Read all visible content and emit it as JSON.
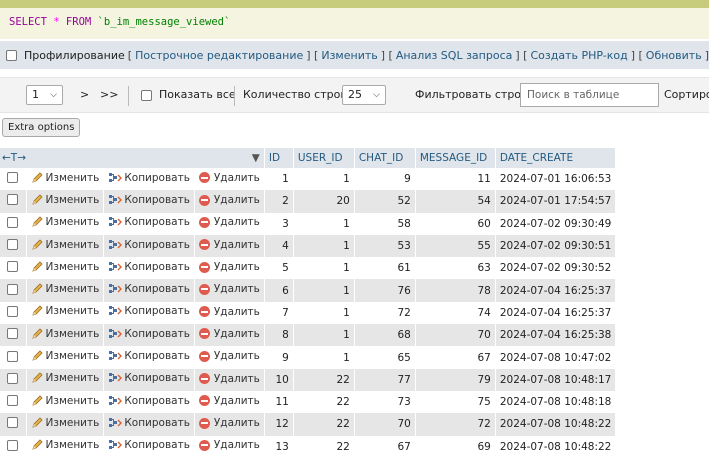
{
  "sql": {
    "keyword1": "SELECT",
    "star": "*",
    "keyword2": "FROM",
    "table": "`b_im_message_viewed`"
  },
  "links": {
    "profiling_label": "Профилирование",
    "items": [
      "Построчное редактирование",
      "Изменить",
      "Анализ SQL запроса",
      "Создать PHP-код",
      "Обновить"
    ]
  },
  "nav": {
    "page_value": "1",
    "next": ">",
    "last": ">>",
    "show_all": "Показать все",
    "rows_label": "Количество строк:",
    "rows_value": "25",
    "filter_label": "Фильтровать строки:",
    "search_placeholder": "Поиск в таблице",
    "sort_label": "Сортиров"
  },
  "extra_options": "Extra options",
  "table": {
    "toggle_symbol": "←T→",
    "sort_indicator": "▼",
    "columns": [
      "ID",
      "USER_ID",
      "CHAT_ID",
      "MESSAGE_ID",
      "DATE_CREATE"
    ],
    "actions": {
      "edit": "Изменить",
      "copy": "Копировать",
      "delete": "Удалить"
    },
    "rows": [
      [
        "1",
        "1",
        "9",
        "11",
        "2024-07-01 16:06:53"
      ],
      [
        "2",
        "20",
        "52",
        "54",
        "2024-07-01 17:54:57"
      ],
      [
        "3",
        "1",
        "58",
        "60",
        "2024-07-02 09:30:49"
      ],
      [
        "4",
        "1",
        "53",
        "55",
        "2024-07-02 09:30:51"
      ],
      [
        "5",
        "1",
        "61",
        "63",
        "2024-07-02 09:30:52"
      ],
      [
        "6",
        "1",
        "76",
        "78",
        "2024-07-04 16:25:37"
      ],
      [
        "7",
        "1",
        "72",
        "74",
        "2024-07-04 16:25:37"
      ],
      [
        "8",
        "1",
        "68",
        "70",
        "2024-07-04 16:25:38"
      ],
      [
        "9",
        "1",
        "65",
        "67",
        "2024-07-08 10:47:02"
      ],
      [
        "10",
        "22",
        "77",
        "79",
        "2024-07-08 10:48:17"
      ],
      [
        "11",
        "22",
        "73",
        "75",
        "2024-07-08 10:48:18"
      ],
      [
        "12",
        "22",
        "70",
        "72",
        "2024-07-08 10:48:22"
      ],
      [
        "13",
        "22",
        "67",
        "69",
        "2024-07-08 10:48:22"
      ]
    ]
  },
  "colors": {
    "header_bg": "#dfe5ea",
    "link": "#235a81",
    "row_alt": "#e6e6e6",
    "delete": "#e05b4f"
  }
}
